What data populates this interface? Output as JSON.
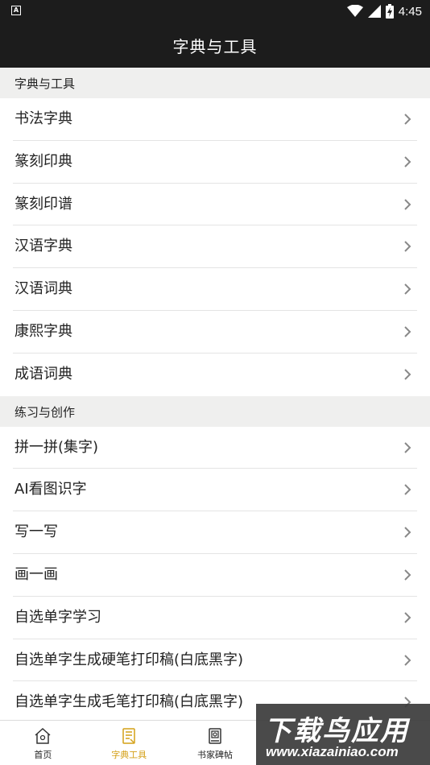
{
  "status_bar": {
    "time": "4:45",
    "notification_icon_text": "A"
  },
  "app_bar": {
    "title": "字典与工具"
  },
  "sections": [
    {
      "header": "字典与工具",
      "items": [
        "书法字典",
        "篆刻印典",
        "篆刻印谱",
        "汉语字典",
        "汉语词典",
        "康熙字典",
        "成语词典"
      ]
    },
    {
      "header": "练习与创作",
      "items": [
        "拼一拼(集字)",
        "AI看图识字",
        "写一写",
        "画一画",
        "自选单字学习",
        "自选单字生成硬笔打印稿(白底黑字)",
        "自选单字生成毛笔打印稿(白底黑字)"
      ]
    }
  ],
  "tab_bar": {
    "tabs": [
      {
        "label": "首页",
        "icon": "home-icon",
        "active": false
      },
      {
        "label": "字典工具",
        "icon": "dictionary-icon",
        "active": true
      },
      {
        "label": "书家碑帖",
        "icon": "book-icon",
        "active": false
      },
      {
        "label": "",
        "icon": "",
        "active": false
      },
      {
        "label": "",
        "icon": "",
        "active": false
      }
    ]
  },
  "watermark": {
    "title": "下载鸟应用",
    "url": "www.xiazainiao.com"
  },
  "colors": {
    "bar_background": "#1c1c1c",
    "section_background": "#efefee",
    "active_tab": "#d4a017"
  }
}
